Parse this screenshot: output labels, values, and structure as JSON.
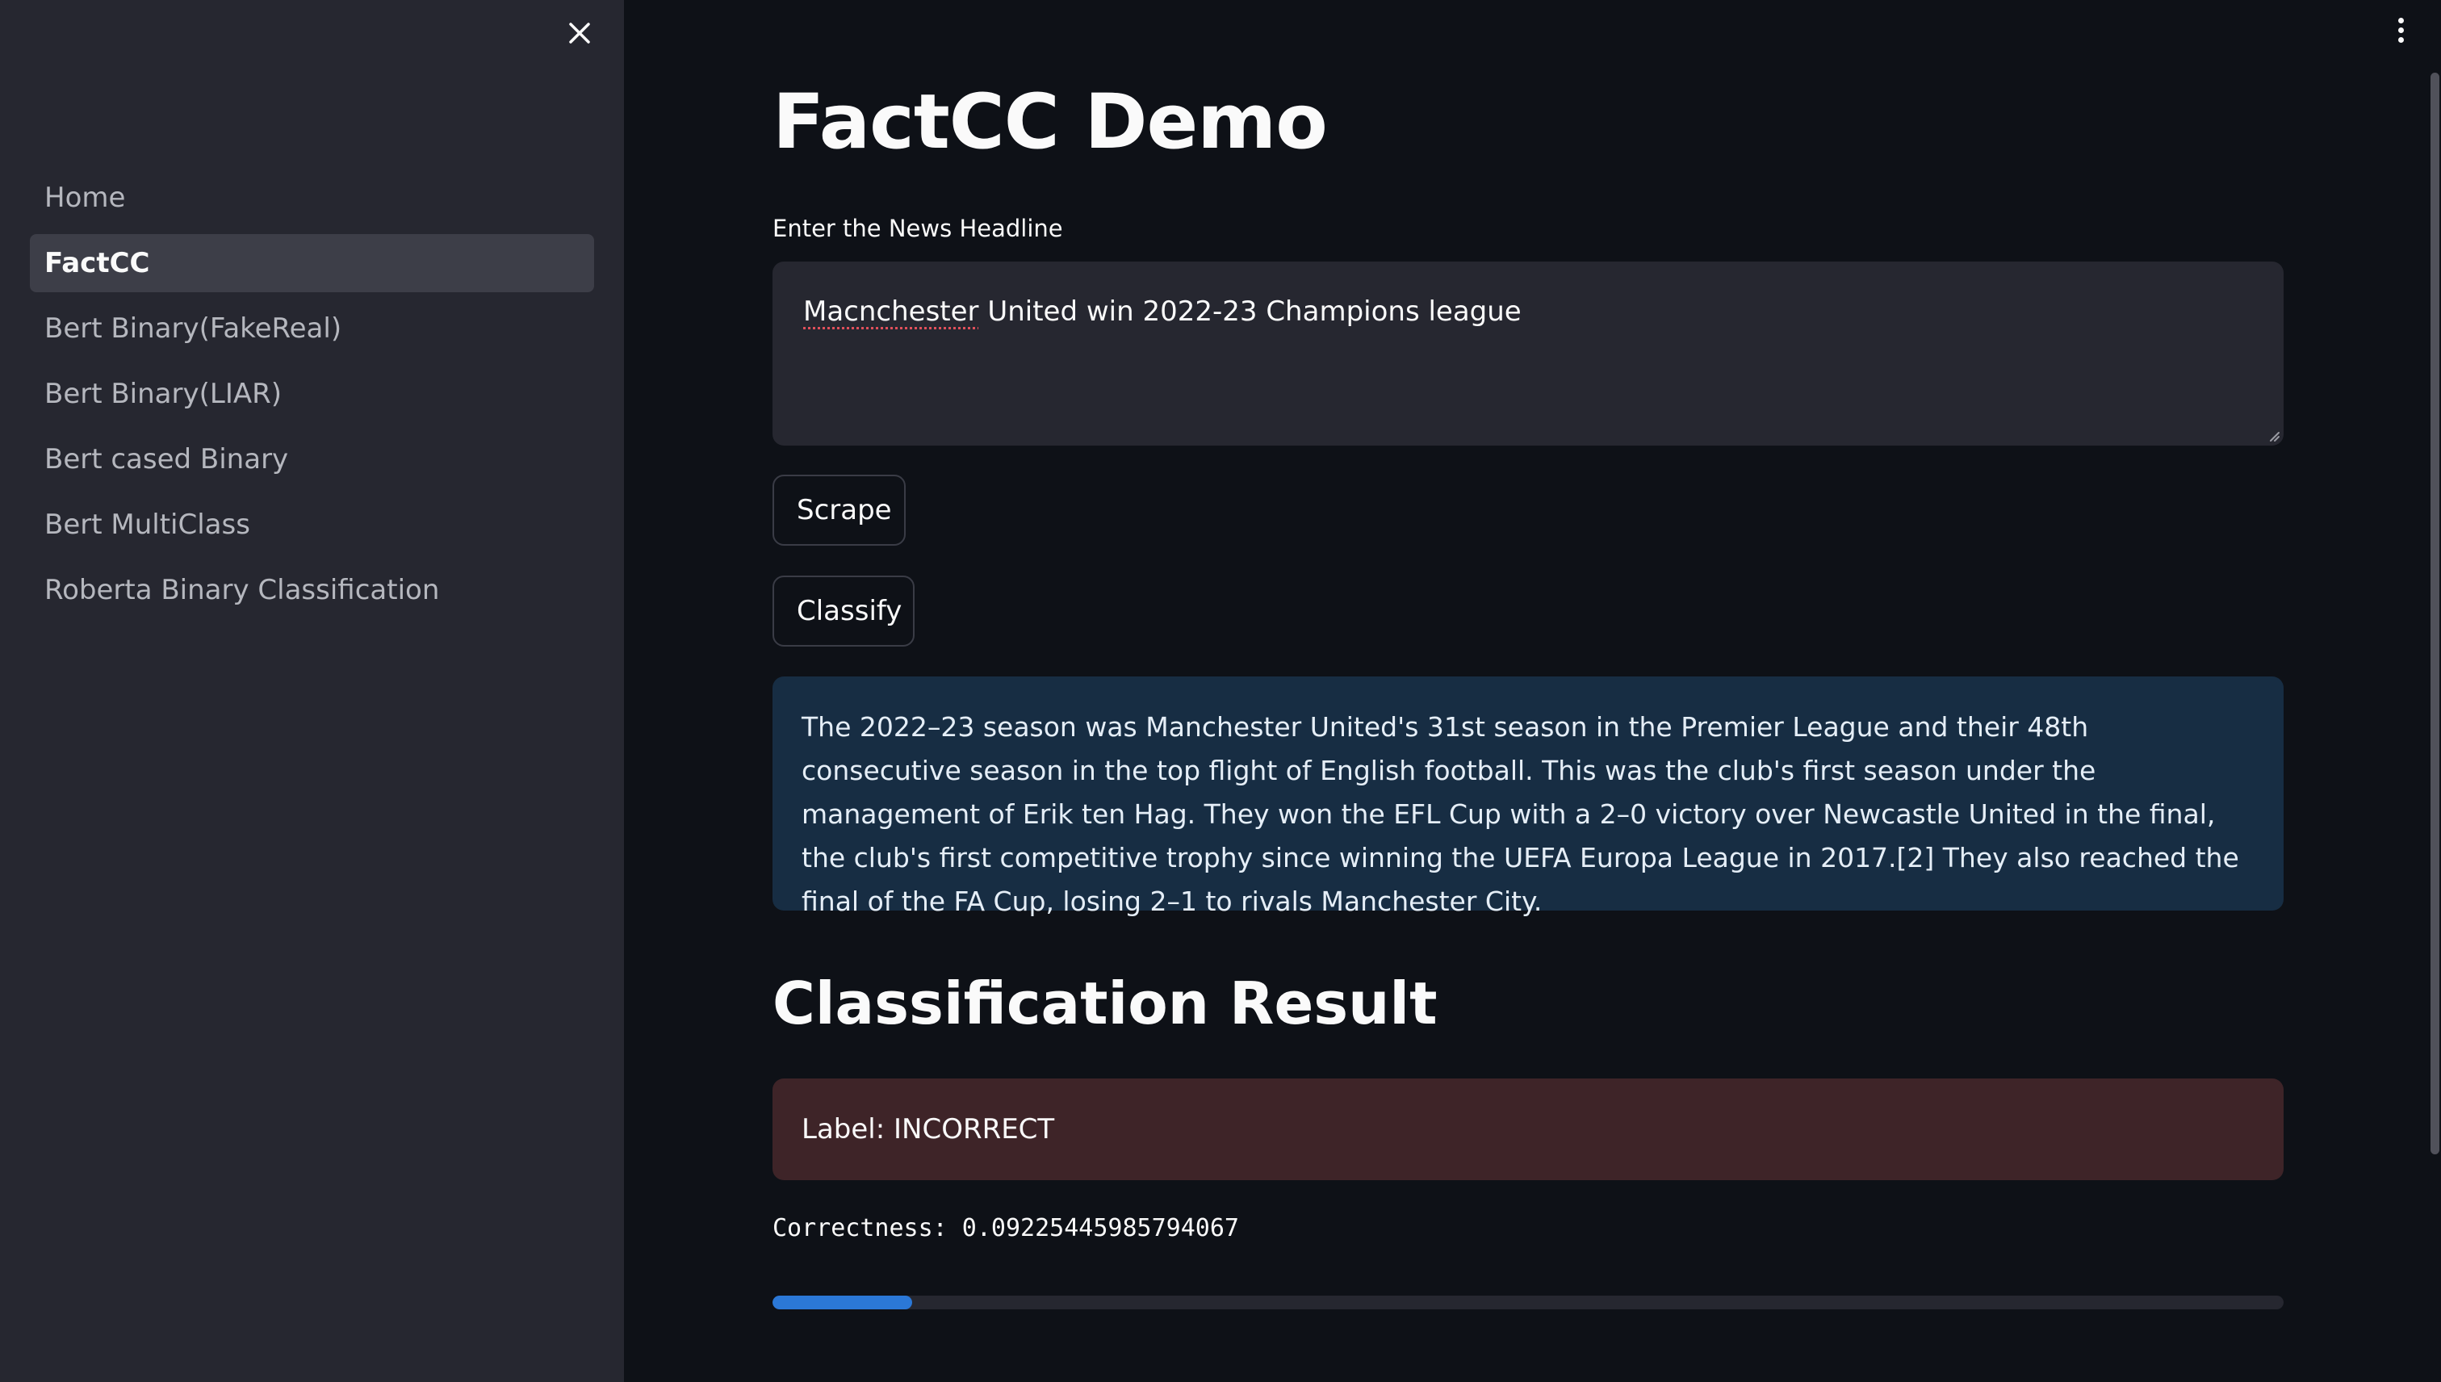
{
  "sidebar": {
    "items": [
      {
        "label": "Home",
        "active": false
      },
      {
        "label": "FactCC",
        "active": true
      },
      {
        "label": "Bert Binary(FakeReal)",
        "active": false
      },
      {
        "label": "Bert Binary(LIAR)",
        "active": false
      },
      {
        "label": "Bert cased Binary",
        "active": false
      },
      {
        "label": "Bert MultiClass",
        "active": false
      },
      {
        "label": "Roberta Binary Classification",
        "active": false
      }
    ]
  },
  "main": {
    "title": "FactCC Demo",
    "input_label": "Enter the News Headline",
    "headline": {
      "misspelled_word": "Macnchester",
      "rest": " United win 2022-23 Champions league"
    },
    "scrape_label": "Scrape",
    "classify_label": "Classify",
    "scraped_text": "The 2022–23 season was Manchester United's 31st season in the Premier League and their 48th consecutive season in the top flight of English football. This was the club's first season under the management of Erik ten Hag. They won the EFL Cup with a 2–0 victory over Newcastle United in the final, the club's first competitive trophy since winning the UEFA Europa League in 2017.[2] They also reached the final of the FA Cup, losing 2–1 to rivals Manchester City.",
    "result_title": "Classification Result",
    "result_label": "Label: INCORRECT",
    "correctness_text": "Correctness: 0.09225445985794067",
    "correctness_value": 0.09225445985794067
  },
  "colors": {
    "background": "#0e1117",
    "sidebar": "#262730",
    "info_box": "#172d43",
    "error_box": "#3e2428",
    "progress": "#2b78d7"
  },
  "icons": {
    "close": "close-icon",
    "menu": "kebab-menu-icon",
    "resize": "resize-handle-icon"
  }
}
